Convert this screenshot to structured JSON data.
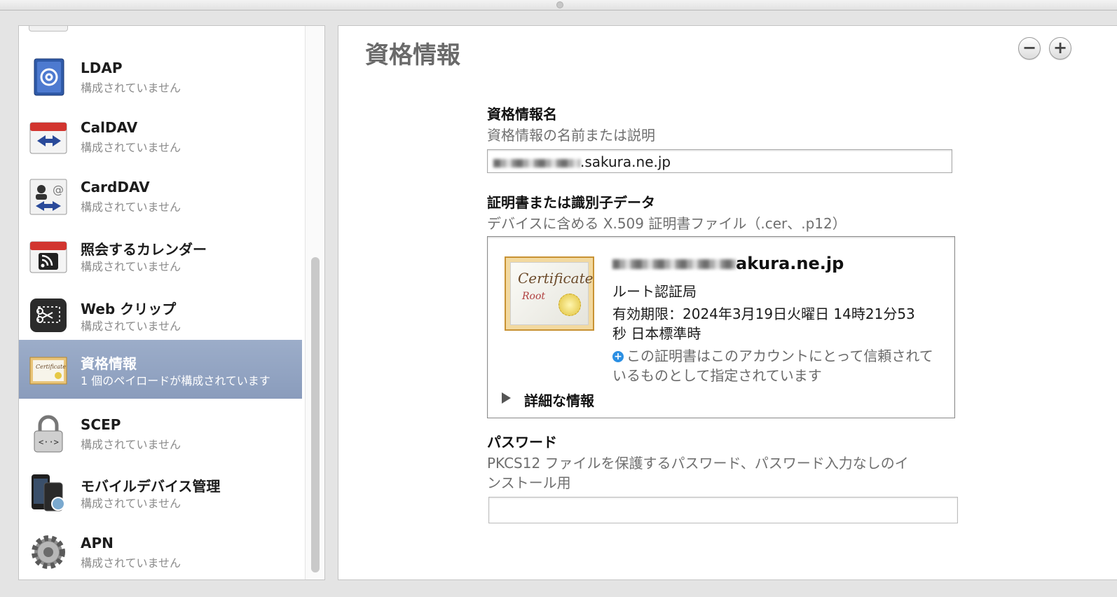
{
  "sidebar": {
    "items": [
      {
        "title": "LDAP",
        "status": "構成されていません",
        "icon": "ldap-at-icon"
      },
      {
        "title": "CalDAV",
        "status": "構成されていません",
        "icon": "caldav-calendar-icon"
      },
      {
        "title": "CardDAV",
        "status": "構成されていません",
        "icon": "carddav-contact-icon"
      },
      {
        "title": "照会するカレンダー",
        "status": "構成されていません",
        "icon": "subscribed-calendar-icon"
      },
      {
        "title": "Web クリップ",
        "status": "構成されていません",
        "icon": "webclip-scissors-icon"
      },
      {
        "title": "資格情報",
        "status": "1 個のペイロードが構成されています",
        "icon": "certificate-icon",
        "selected": true
      },
      {
        "title": "SCEP",
        "status": "構成されていません",
        "icon": "scep-lock-icon"
      },
      {
        "title": "モバイルデバイス管理",
        "status": "構成されていません",
        "icon": "mdm-device-icon"
      },
      {
        "title": "APN",
        "status": "構成されていません",
        "icon": "apn-gear-icon"
      }
    ]
  },
  "main": {
    "title": "資格情報",
    "remove_label": "−",
    "add_label": "+",
    "name_field": {
      "label": "資格情報名",
      "description": "資格情報の名前または説明",
      "value_suffix": ".sakura.ne.jp"
    },
    "cert_section": {
      "label": "証明書または識別子データ",
      "description": "デバイスに含める X.509 証明書ファイル（.cer、.p12）",
      "cert_image_text": "Certificate",
      "cert_image_sub": "Root",
      "cert_name_suffix": "akura.ne.jp",
      "issuer": "ルート認証局",
      "expiry_line1": "有効期限：2024年3月19日火曜日 14時21分53",
      "expiry_line2": "秒 日本標準時",
      "trust_text": "この証明書はこのアカウントにとって信頼されているものとして指定されています",
      "more_info": "詳細な情報"
    },
    "password_section": {
      "label": "パスワード",
      "description_line1": "PKCS12 ファイルを保護するパスワード、パスワード入力なしのイ",
      "description_line2": "ンストール用",
      "value": ""
    }
  },
  "colors": {
    "selection": "#8fa1c0",
    "trust_icon": "#2b8fe3",
    "cert_border": "#c89233"
  }
}
